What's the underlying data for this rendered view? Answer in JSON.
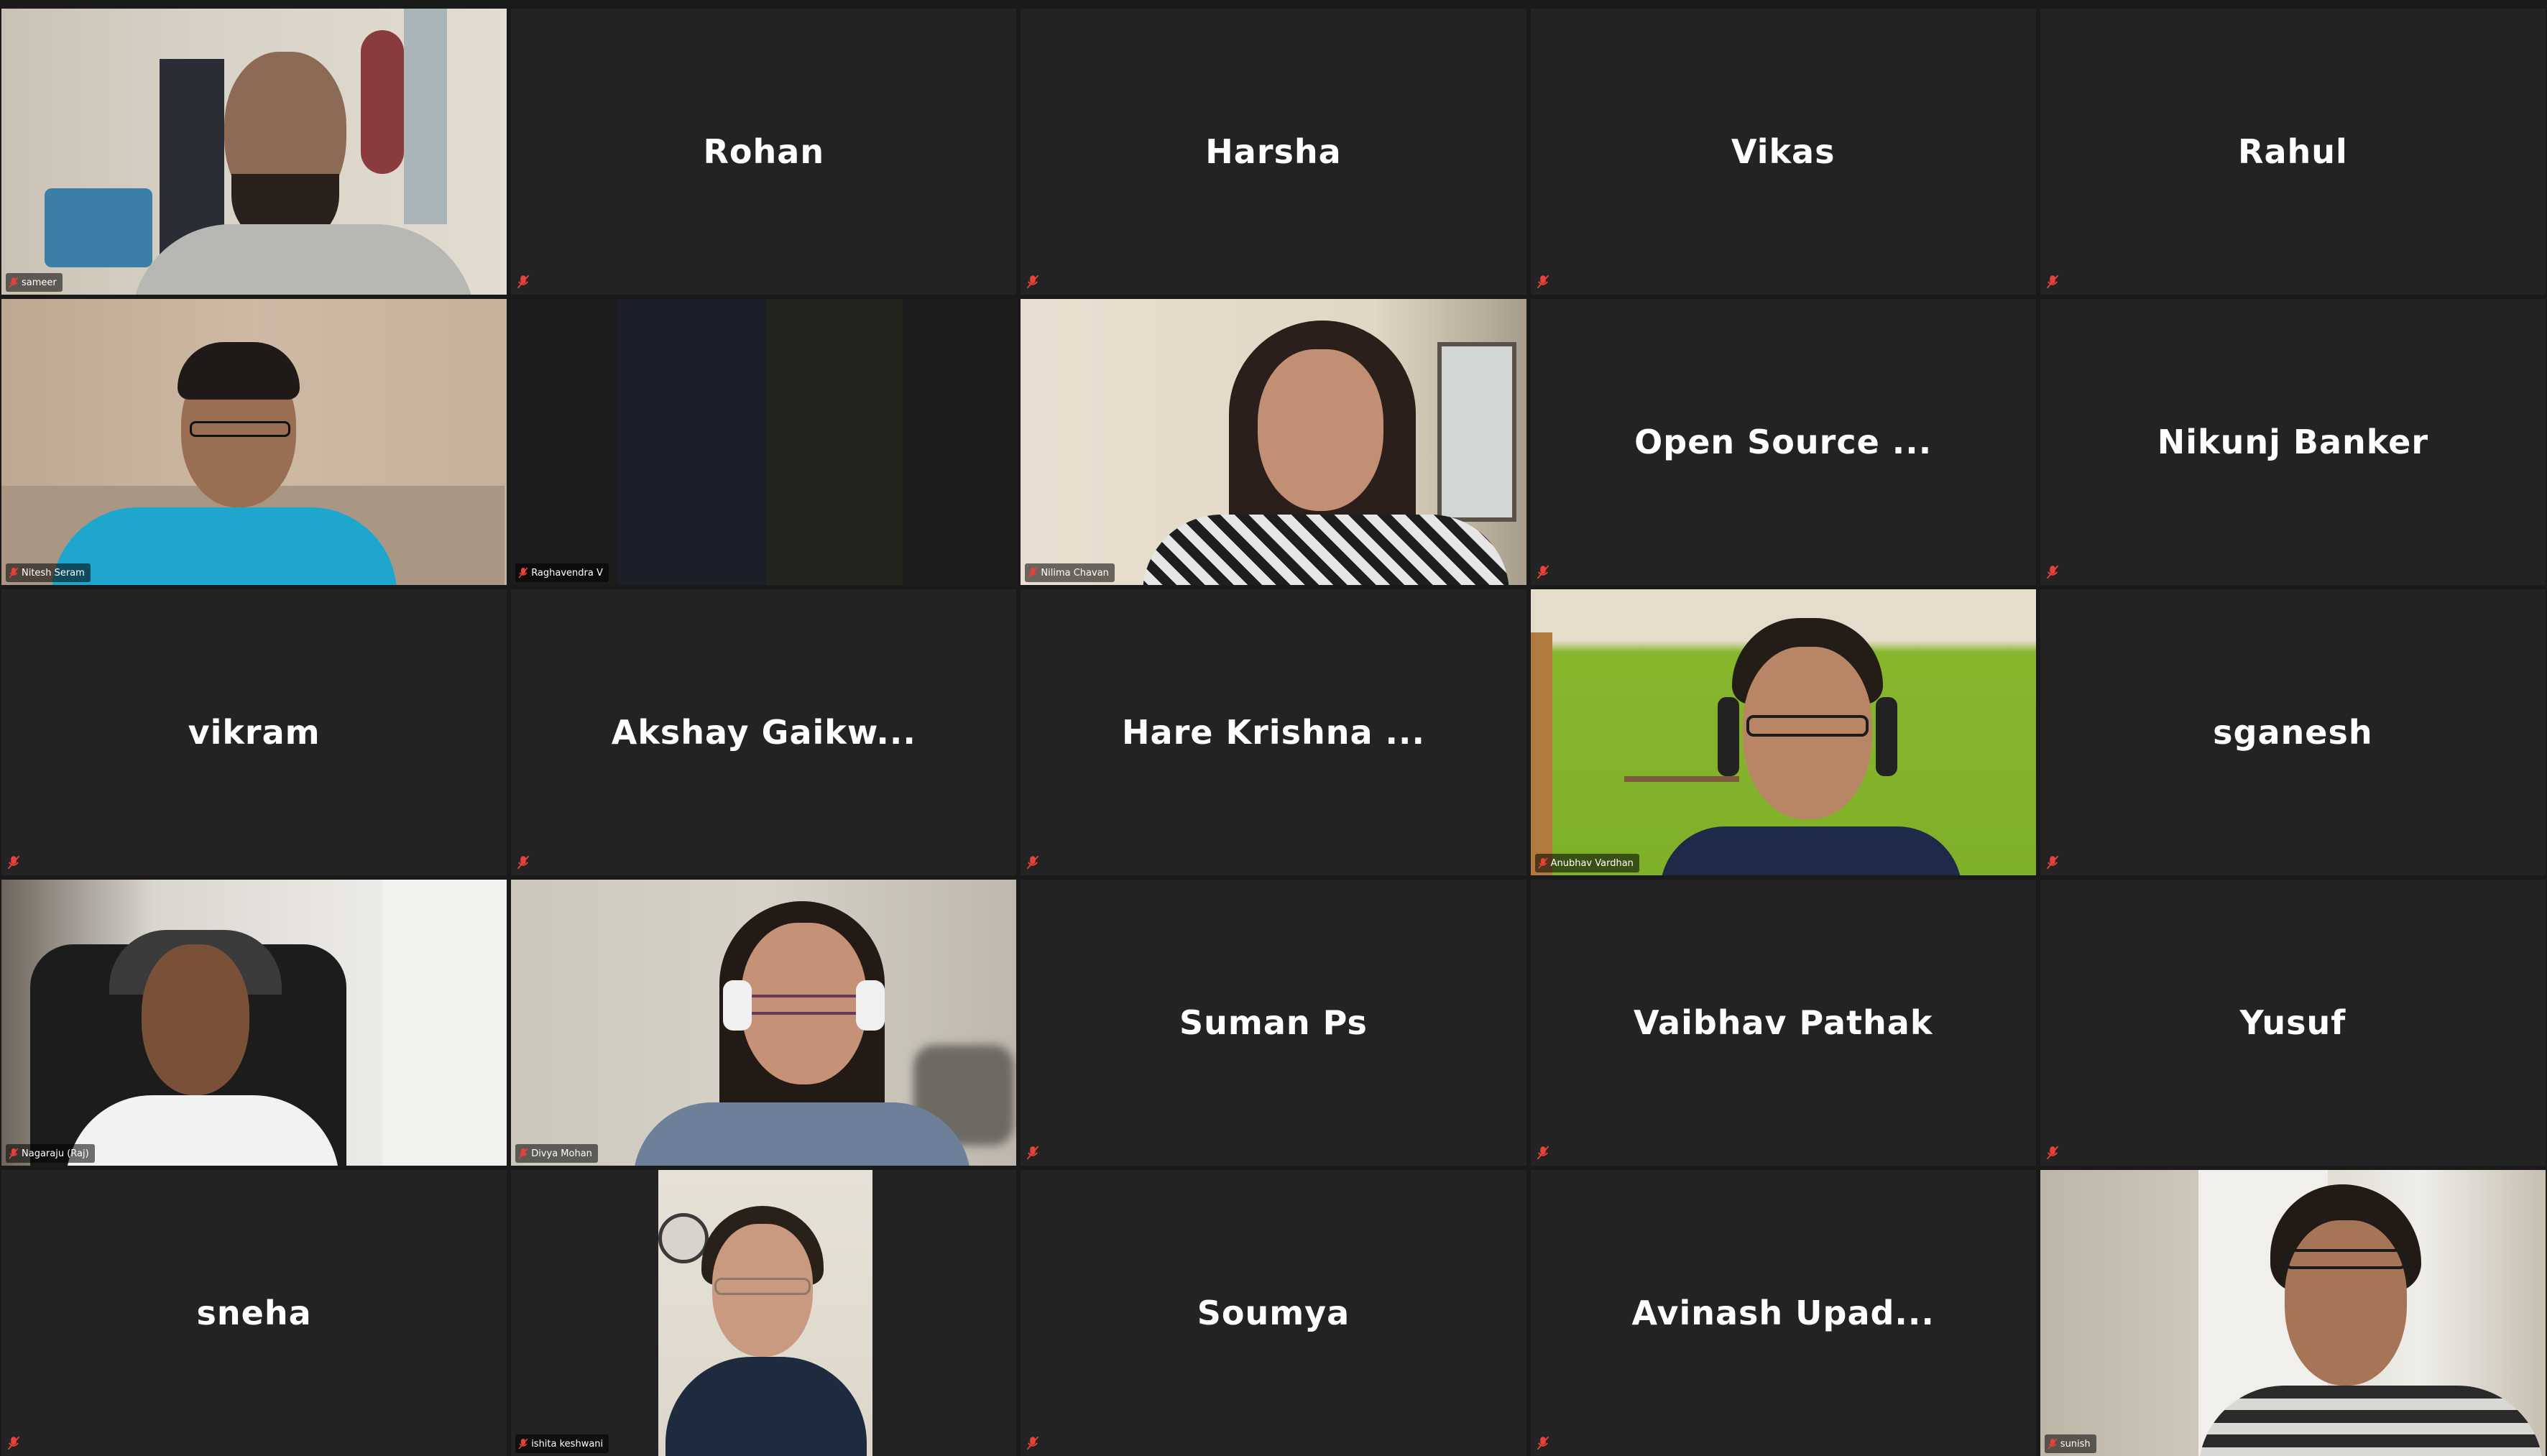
{
  "meeting": {
    "participants": [
      {
        "name": "sameer",
        "video": true
      },
      {
        "name": "Rohan",
        "video": false
      },
      {
        "name": "Harsha",
        "video": false
      },
      {
        "name": "Vikas",
        "video": false
      },
      {
        "name": "Rahul",
        "video": false
      },
      {
        "name": "Nitesh Seram",
        "video": true
      },
      {
        "name": "Raghavendra V",
        "video": true
      },
      {
        "name": "Nilima Chavan",
        "video": true
      },
      {
        "name": "Open Source ...",
        "video": false
      },
      {
        "name": "Nikunj Banker",
        "video": false
      },
      {
        "name": "vikram",
        "video": false
      },
      {
        "name": "Akshay Gaikw...",
        "video": false
      },
      {
        "name": "Hare Krishna ...",
        "video": false
      },
      {
        "name": "Anubhav Vardhan",
        "video": true
      },
      {
        "name": "sganesh",
        "video": false
      },
      {
        "name": "Nagaraju (Raj)",
        "video": true
      },
      {
        "name": "Divya Mohan",
        "video": true
      },
      {
        "name": "Suman Ps",
        "video": false
      },
      {
        "name": "Vaibhav Pathak",
        "video": false
      },
      {
        "name": "Yusuf",
        "video": false
      },
      {
        "name": "sneha",
        "video": false
      },
      {
        "name": "ishita keshwani",
        "video": true
      },
      {
        "name": "Soumya",
        "video": false
      },
      {
        "name": "Avinash Upad...",
        "video": false
      },
      {
        "name": "sunish",
        "video": true
      }
    ],
    "muted_icon": "muted-mic-icon",
    "colors": {
      "background": "#1a1a1a",
      "tile": "#232323",
      "muted": "#e8413a",
      "name_text": "#ffffff"
    }
  }
}
